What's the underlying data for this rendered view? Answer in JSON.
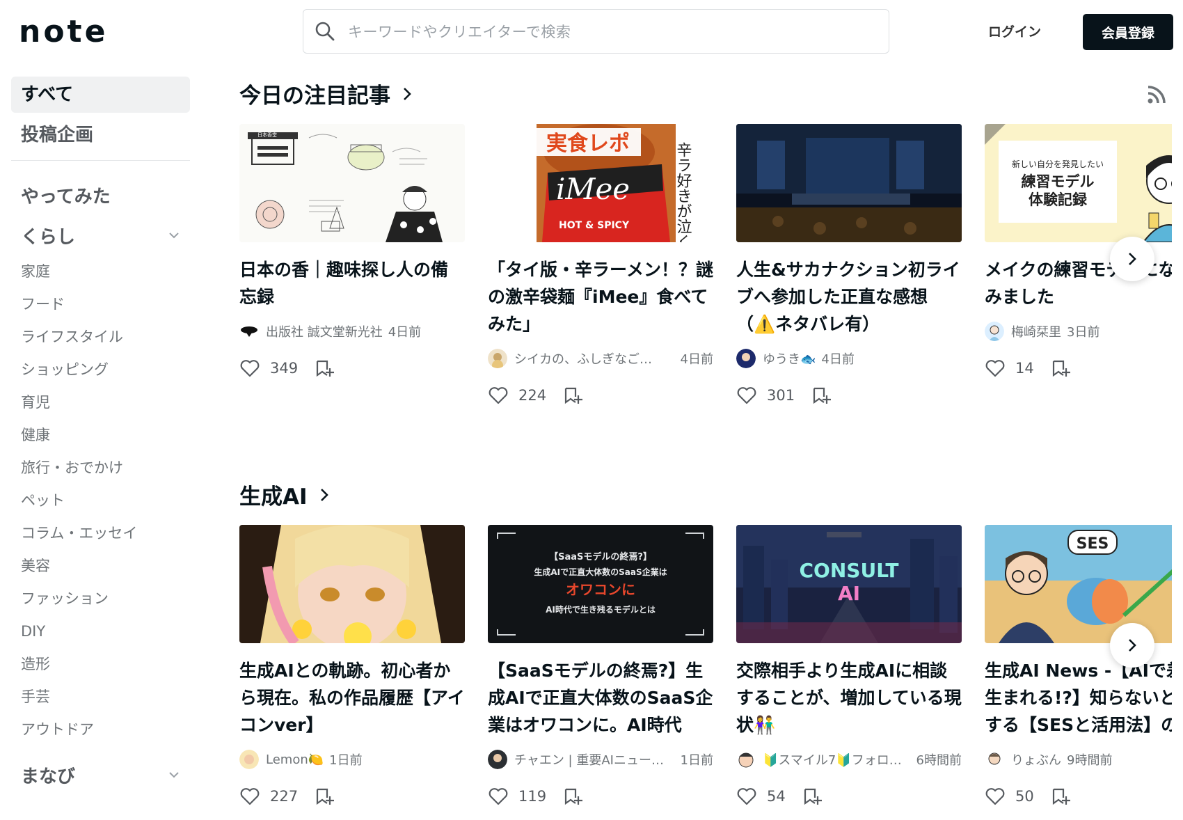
{
  "header": {
    "logo_text": "note",
    "search_placeholder": "キーワードやクリエイターで検索",
    "login_label": "ログイン",
    "signup_label": "会員登録"
  },
  "sidebar": {
    "top_items": [
      {
        "label": "すべて",
        "active": true
      },
      {
        "label": "投稿企画",
        "active": false
      }
    ],
    "section_yattemita": "やってみた",
    "section_kurashi": "くらし",
    "kurashi_items": [
      "家庭",
      "フード",
      "ライフスタイル",
      "ショッピング",
      "育児",
      "健康",
      "旅行・おでかけ",
      "ペット",
      "コラム・エッセイ",
      "美容",
      "ファッション",
      "DIY",
      "造形",
      "手芸",
      "アウトドア"
    ],
    "section_manabi": "まなび"
  },
  "featured": {
    "title": "今日の注目記事",
    "cards": [
      {
        "title": "日本の香｜趣味探し人の備忘録",
        "author": "出版社 誠文堂新光社",
        "time": "4日前",
        "likes": "349"
      },
      {
        "title": "「タイ版・辛ラーメン！？謎の激辛袋麺『iMee』食べてみた」",
        "author": "シイカの、ふしぎなご…",
        "time": "4日前",
        "likes": "224"
      },
      {
        "title": "人生&サカナクション初ライブへ参加した正直な感想（⚠️ネタバレ有）",
        "author": "ゆうき🐟",
        "time": "4日前",
        "likes": "301"
      },
      {
        "title": "メイクの練習モデルになってみました",
        "author": "梅崎栞里",
        "time": "3日前",
        "likes": "14"
      }
    ],
    "thumb_texts": {
      "c1_label": "日本香堂",
      "c2_top": "実食レポ",
      "c2_brand": "iMee",
      "c2_spicy": "HOT & SPICY",
      "c2_side": "辛ラ好きが泣く",
      "c4_line1": "新しい自分を発見したい",
      "c4_line2": "練習モデル",
      "c4_line3": "体験記録"
    }
  },
  "ai_section": {
    "title": "生成AI",
    "cards": [
      {
        "title": "生成AIとの軌跡。初心者から現在。私の作品履歴【アイコンver】",
        "author": "Lemon🍋",
        "time": "1日前",
        "likes": "227"
      },
      {
        "title": "【SaaSモデルの終焉?】生成AIで正直大体数のSaaS企業はオワコンに。AI時代で…",
        "author": "チャエン | 重要AIニュー…",
        "time": "1日前",
        "likes": "119"
      },
      {
        "title": "交際相手より生成AIに相談することが、増加している現状👫",
        "author": "🔰スマイル7🔰フォロ…",
        "time": "6時間前",
        "likes": "54"
      },
      {
        "title": "生成AI News -【AIで差が生まれる!?】知らないと損する【SESと活用法】の実態",
        "author": "りょぶん",
        "time": "9時間前",
        "likes": "50"
      }
    ],
    "thumb_texts": {
      "c2_line1": "【SaaSモデルの終焉?】",
      "c2_line2": "生成AIで正直大体数のSaaS企業は",
      "c2_line3": "オワコンに",
      "c2_line4": "AI時代で生き残るモデルとは",
      "c3_line1": "CONSULT",
      "c3_line2": "AI",
      "c4_badge": "SES"
    }
  },
  "colors": {
    "primary": "#08131a",
    "muted": "#6e7377",
    "active_bg": "#f0f1f2"
  }
}
